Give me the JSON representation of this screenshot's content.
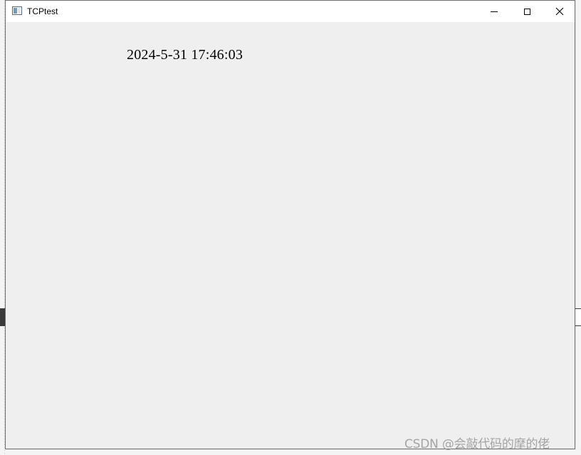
{
  "window": {
    "title": "TCPtest",
    "controls": {
      "minimize_icon": "minimize-icon",
      "maximize_icon": "maximize-icon",
      "close_icon": "close-icon"
    }
  },
  "client": {
    "datetime": "2024-5-31 17:46:03"
  },
  "watermark": {
    "text": "CSDN @会敲代码的摩的佬"
  },
  "colors": {
    "titlebar_bg": "#ffffff",
    "client_bg": "#efefef",
    "window_border": "#6f6f6f",
    "text": "#000000"
  }
}
